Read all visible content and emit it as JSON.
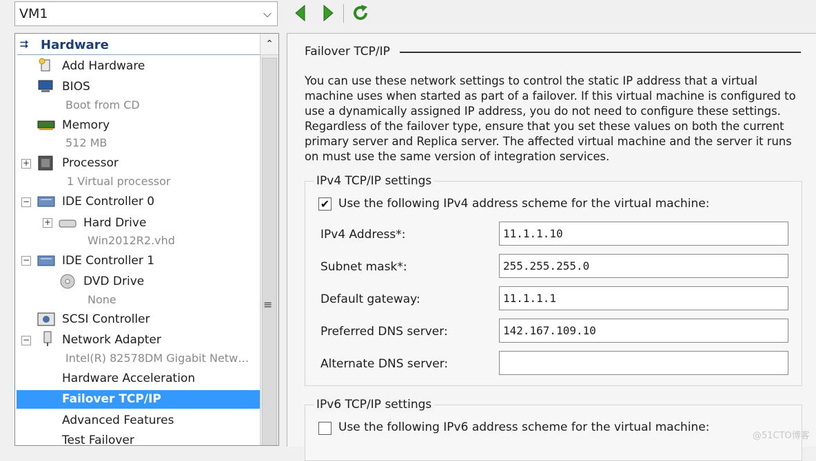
{
  "vm_selector": {
    "value": "VM1"
  },
  "toolbar": {
    "previous_icon": "back-arrow-icon",
    "next_icon": "forward-arrow-icon",
    "refresh_icon": "refresh-icon"
  },
  "tree": {
    "header": "Hardware",
    "items": [
      {
        "label": "Add Hardware",
        "icon": "add-hardware-icon"
      },
      {
        "label": "BIOS",
        "sub": "Boot from CD",
        "icon": "bios-icon"
      },
      {
        "label": "Memory",
        "sub": "512 MB",
        "icon": "memory-icon"
      },
      {
        "label": "Processor",
        "sub": "1 Virtual processor",
        "icon": "processor-icon"
      },
      {
        "label": "IDE Controller 0",
        "icon": "controller-icon"
      },
      {
        "label": "Hard Drive",
        "sub": "Win2012R2.vhd",
        "icon": "hard-drive-icon"
      },
      {
        "label": "IDE Controller 1",
        "icon": "controller-icon"
      },
      {
        "label": "DVD Drive",
        "sub": "None",
        "icon": "dvd-drive-icon"
      },
      {
        "label": "SCSI Controller",
        "icon": "scsi-icon"
      },
      {
        "label": "Network Adapter",
        "sub": "Intel(R) 82578DM Gigabit Netw…",
        "icon": "network-adapter-icon"
      },
      {
        "label": "Hardware Acceleration"
      },
      {
        "label": "Failover TCP/IP",
        "selected": true
      },
      {
        "label": "Advanced Features"
      },
      {
        "label": "Test Failover"
      }
    ]
  },
  "details": {
    "title": "Failover TCP/IP",
    "description": "You can use these network settings to control the static IP address that a virtual machine uses when started as part of a failover. If this virtual machine is configured to use a dynamically assigned IP address, you do not need to configure these settings. Regardless of the failover type, ensure that you set these values on both the current primary server and Replica server. The affected virtual machine and the server it runs on must use the same version of integration services.",
    "ipv4": {
      "group_title": "IPv4 TCP/IP settings",
      "checkbox_label": "Use the following IPv4 address scheme for the virtual machine:",
      "checked": true,
      "fields": [
        {
          "label": "IPv4 Address*:",
          "value": "11.1.1.10"
        },
        {
          "label": "Subnet mask*:",
          "value": "255.255.255.0"
        },
        {
          "label": "Default gateway:",
          "value": "11.1.1.1"
        },
        {
          "label": "Preferred DNS server:",
          "value": "142.167.109.10"
        },
        {
          "label": "Alternate DNS server:",
          "value": ""
        }
      ]
    },
    "ipv6": {
      "group_title": "IPv6 TCP/IP settings",
      "checkbox_label": "Use the following IPv6 address scheme for the virtual machine:",
      "checked": false
    }
  },
  "watermark": "@51CTO博客",
  "colors": {
    "selection": "#3399ff",
    "header_text": "#1b3f7a",
    "arrow_green": "#3a9a2a"
  }
}
